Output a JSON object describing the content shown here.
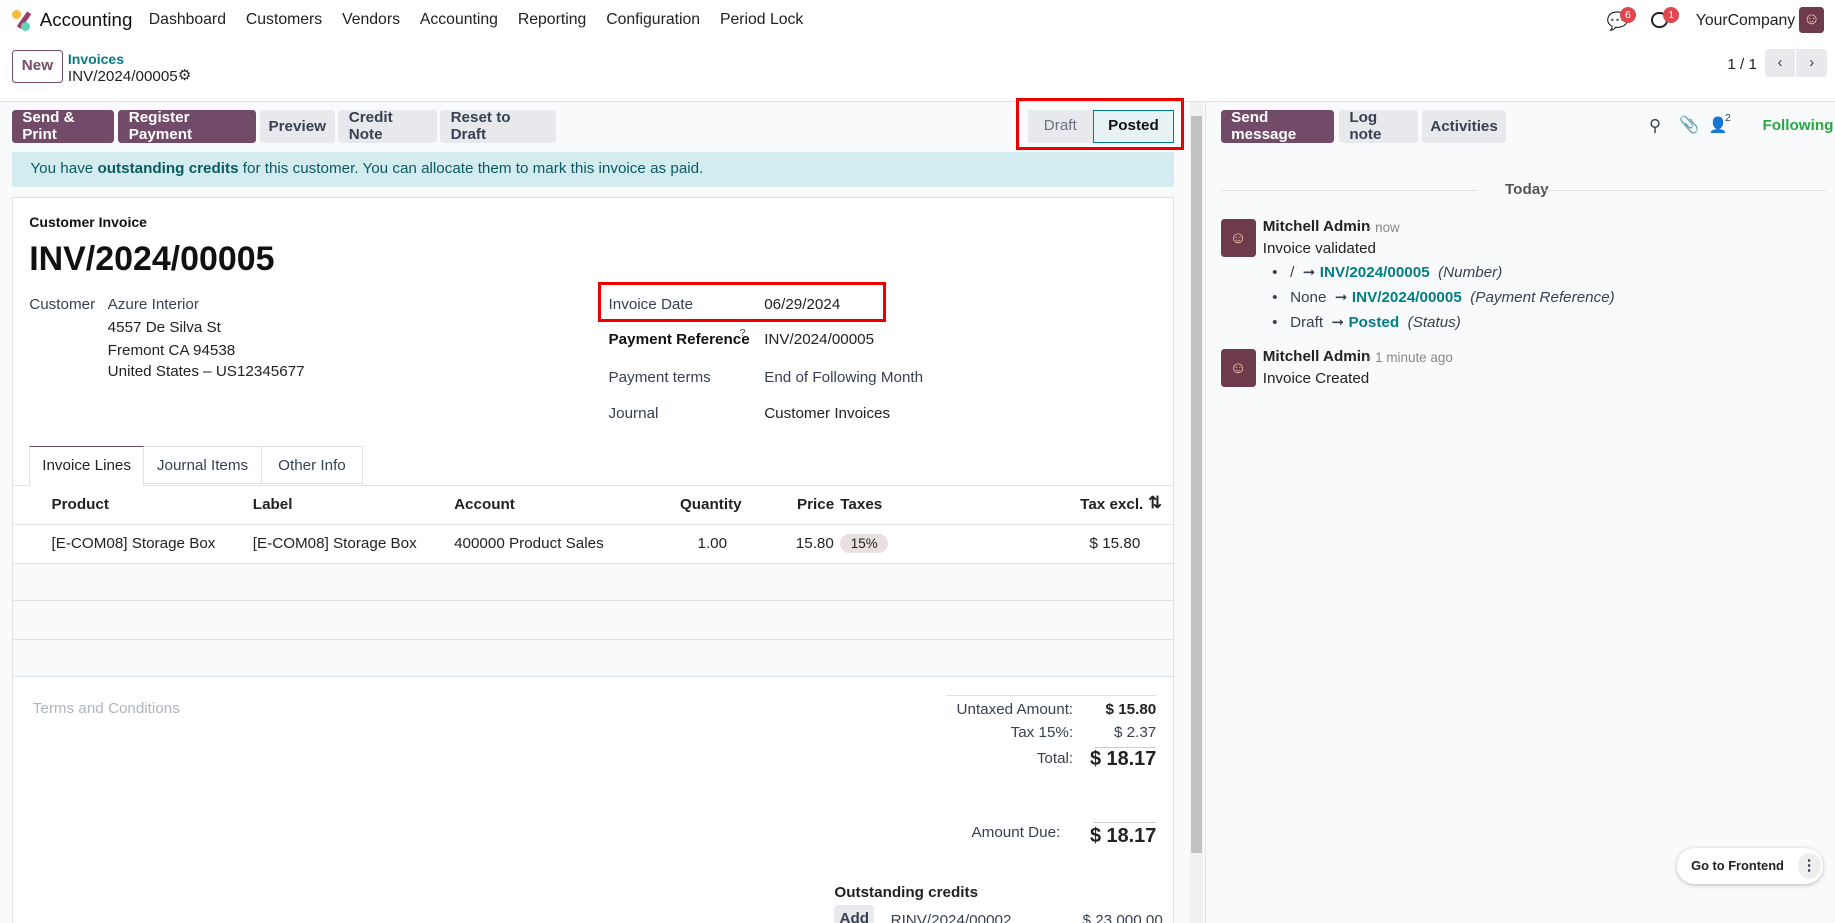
{
  "navbar": {
    "app": "Accounting",
    "menu": [
      "Dashboard",
      "Customers",
      "Vendors",
      "Accounting",
      "Reporting",
      "Configuration",
      "Period Lock"
    ],
    "messages_badge": "6",
    "activities_badge": "1",
    "company": "YourCompany"
  },
  "control": {
    "new_label": "New",
    "breadcrumb_parent": "Invoices",
    "breadcrumb_current": "INV/2024/00005",
    "pager": "1 / 1"
  },
  "actions": {
    "send_print": "Send & Print",
    "register_payment": "Register Payment",
    "preview": "Preview",
    "credit_note": "Credit Note",
    "reset_draft": "Reset to Draft"
  },
  "status": {
    "steps": [
      "Draft",
      "Posted"
    ],
    "current": "Posted"
  },
  "alert": {
    "pre": "You have ",
    "bold": "outstanding credits",
    "post": " for this customer. You can allocate them to mark this invoice as paid."
  },
  "form": {
    "type": "Customer Invoice",
    "title": "INV/2024/00005",
    "customer_label": "Customer",
    "customer": "Azure Interior",
    "address": [
      "4557 De Silva St",
      "Fremont CA 94538",
      "United States – US12345677"
    ],
    "invoice_date_label": "Invoice Date",
    "invoice_date": "06/29/2024",
    "payment_ref_label": "Payment Reference",
    "payment_ref_help": "?",
    "payment_ref": "INV/2024/00005",
    "payment_terms_label": "Payment terms",
    "payment_terms": "End of Following Month",
    "journal_label": "Journal",
    "journal": "Customer Invoices"
  },
  "tabs": [
    "Invoice Lines",
    "Journal Items",
    "Other Info"
  ],
  "table": {
    "headers": [
      "Product",
      "Label",
      "Account",
      "Quantity",
      "Price",
      "Taxes",
      "Tax excl."
    ],
    "rows": [
      {
        "product": "[E-COM08] Storage Box",
        "label": "[E-COM08] Storage Box",
        "account": "400000 Product Sales",
        "quantity": "1.00",
        "price": "15.80",
        "taxes": "15%",
        "subtotal": "$ 15.80"
      }
    ]
  },
  "terms_placeholder": "Terms and Conditions",
  "totals": {
    "untaxed_label": "Untaxed Amount:",
    "untaxed": "$ 15.80",
    "tax_label": "Tax 15%:",
    "tax": "$ 2.37",
    "total_label": "Total:",
    "total": "$ 18.17",
    "due_label": "Amount Due:",
    "due": "$ 18.17"
  },
  "credits": {
    "title": "Outstanding credits",
    "add": "Add",
    "ref": "RINV/2024/00002",
    "amount": "$ 23,000.00"
  },
  "chatter": {
    "send_message": "Send message",
    "log_note": "Log note",
    "activities": "Activities",
    "followers": "2",
    "following": "Following",
    "today": "Today",
    "messages": [
      {
        "author": "Mitchell Admin",
        "time": "- now",
        "body": "Invoice validated",
        "changes": [
          {
            "old": "/",
            "new": "INV/2024/00005",
            "field": "(Number)"
          },
          {
            "old": "None",
            "new": "INV/2024/00005",
            "field": "(Payment Reference)"
          },
          {
            "old": "Draft",
            "new": "Posted",
            "field": "(Status)"
          }
        ]
      },
      {
        "author": "Mitchell Admin",
        "time": "- 1 minute ago",
        "body": "Invoice Created"
      }
    ]
  },
  "frontend": "Go to Frontend"
}
